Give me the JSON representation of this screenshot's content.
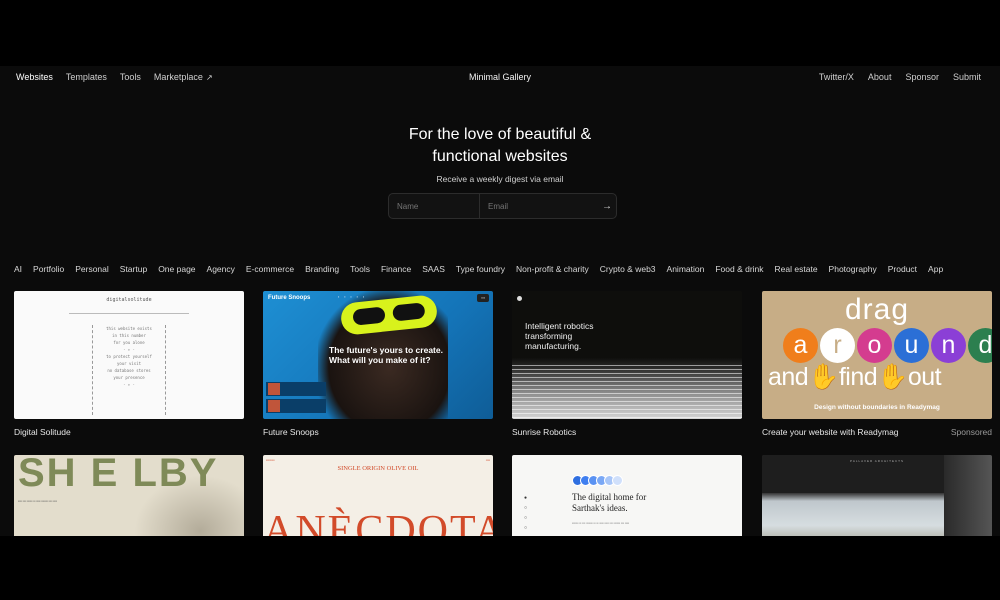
{
  "nav": {
    "left": [
      "Websites",
      "Templates",
      "Tools",
      "Marketplace"
    ],
    "center": "Minimal Gallery",
    "right": [
      "Twitter/X",
      "About",
      "Sponsor",
      "Submit"
    ]
  },
  "hero": {
    "title_line1": "For the love of beautiful &",
    "title_line2": "functional websites",
    "subtitle": "Receive a weekly digest via email",
    "name_placeholder": "Name",
    "email_placeholder": "Email"
  },
  "categories": [
    "AI",
    "Portfolio",
    "Personal",
    "Startup",
    "One page",
    "Agency",
    "E-commerce",
    "Branding",
    "Tools",
    "Finance",
    "SAAS",
    "Type foundry",
    "Non-profit & charity",
    "Crypto & web3",
    "Animation",
    "Food & drink",
    "Real estate",
    "Photography",
    "Product",
    "App"
  ],
  "cards": [
    {
      "title": "Digital Solitude"
    },
    {
      "title": "Future Snoops"
    },
    {
      "title": "Sunrise Robotics"
    },
    {
      "title": "Create your website with Readymag",
      "badge": "Sponsored"
    }
  ],
  "thumbs": {
    "solitude_header": "digitalsolitude",
    "solitude_lines": [
      "this website exists",
      "in this number",
      "for you alone",
      "· ✦ ·",
      "to protect yourself",
      "your visit",
      "no database stores",
      "your presence",
      "· ✦ ·"
    ],
    "snoops_logo": "Future Snoops",
    "snoops_tagline_1": "The future's yours to create.",
    "snoops_tagline_2": "What will you make of it?",
    "robotics_headline_1": "Intelligent robotics",
    "robotics_headline_2": "transforming",
    "robotics_headline_3": "manufacturing.",
    "readymag_drag": "drag",
    "readymag_around": [
      "a",
      "r",
      "o",
      "u",
      "n",
      "d"
    ],
    "readymag_around_colors": [
      "#f07e1b",
      "#ffffff",
      "#d43c8f",
      "#2b6fd6",
      "#8b3fd6",
      "#2c7f4f"
    ],
    "readymag_and": "and",
    "readymag_find": "find",
    "readymag_out": "out",
    "readymag_hand": "✋",
    "readymag_caption": "Design without boundaries in Readymag",
    "shelby": "SH E LBY",
    "olive_top": "SINGLE ORIGIN OLIVE OIL",
    "olive_big": "ANÈCDOTA",
    "sarthak_title_1": "The digital home for",
    "sarthak_title_2": "Sarthak's ideas.",
    "arch_label": "PALLAVER ARCHITECTS"
  },
  "colors": {
    "background": "#000000",
    "accent_olive": "#7f8a58",
    "accent_red": "#d24b2a",
    "accent_yellow": "#d8f21c"
  }
}
